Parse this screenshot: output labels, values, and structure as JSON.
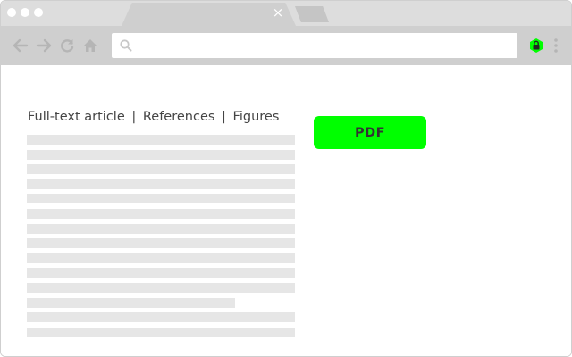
{
  "browser": {
    "tab_close_glyph": "×",
    "omnibox": {
      "value": "",
      "placeholder": ""
    },
    "colors": {
      "chrome_bg": "#dddddd",
      "toolbar_bg": "#cfcfcf",
      "accent": "#00ff00"
    },
    "icons": [
      "back-arrow-icon",
      "forward-arrow-icon",
      "reload-icon",
      "home-icon",
      "search-icon",
      "lock-extension-icon",
      "more-menu-icon"
    ]
  },
  "page": {
    "links": [
      {
        "label": "Full-text article"
      },
      {
        "label": "References"
      },
      {
        "label": "Figures"
      }
    ],
    "separator": "|",
    "pdf_button_label": "PDF",
    "text_lines_count": 14
  }
}
